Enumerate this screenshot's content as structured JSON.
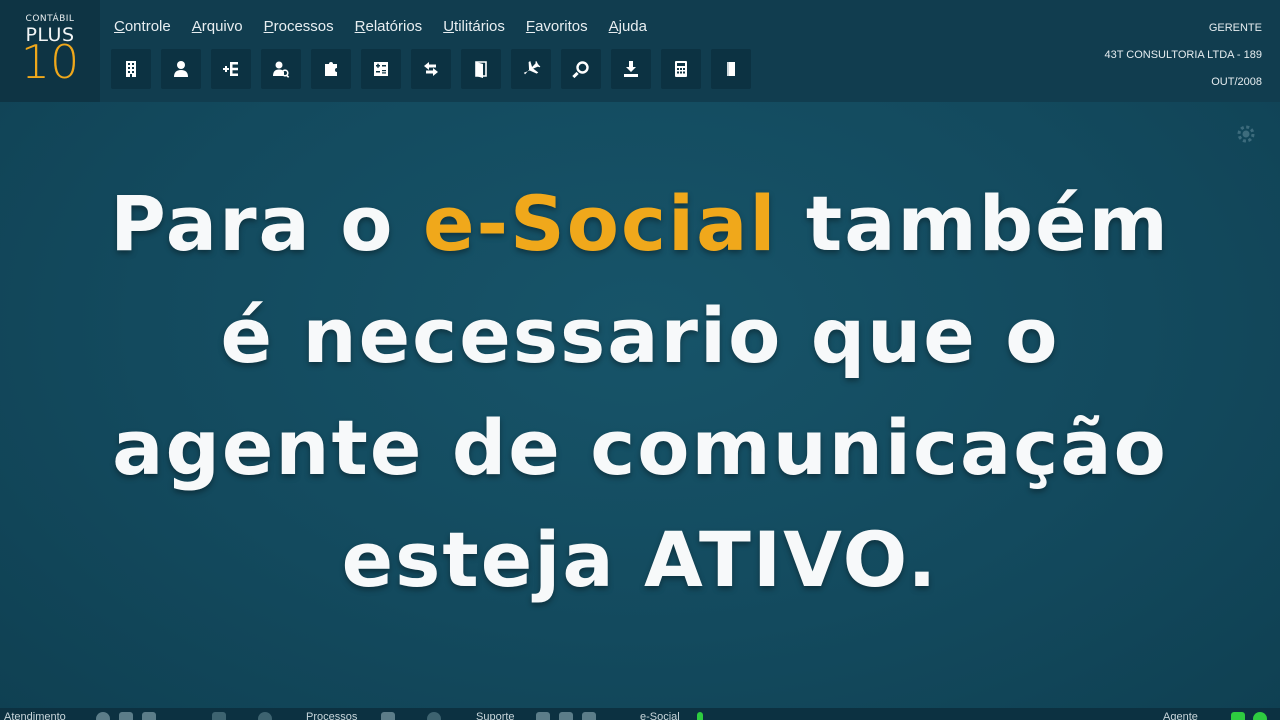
{
  "logo": {
    "small": "CONTÁBIL",
    "plus": "PLUS",
    "number": "10"
  },
  "menu": [
    {
      "first": "C",
      "rest": "ontrole"
    },
    {
      "first": "A",
      "rest": "rquivo"
    },
    {
      "first": "P",
      "rest": "rocessos"
    },
    {
      "first": "R",
      "rest": "elatórios"
    },
    {
      "first": "U",
      "rest": "tilitários"
    },
    {
      "first": "F",
      "rest": "avoritos"
    },
    {
      "first": "Aj",
      "rest": "uda"
    }
  ],
  "toolbar": {
    "icons": [
      "building-icon",
      "person-icon",
      "entry-icon",
      "user-search-icon",
      "puzzle-icon",
      "calc-sheet-icon",
      "transfer-icon",
      "door-icon",
      "airplane-icon",
      "search-icon",
      "download-icon",
      "calculator-icon",
      "book-icon"
    ]
  },
  "user": {
    "role": "GERENTE",
    "company": "43T CONSULTORIA LTDA - 189",
    "period": "OUT/2008"
  },
  "message": {
    "line1_pre": "Para o ",
    "line1_highlight": "e-Social",
    "line1_post": " também",
    "line2": "é necessario que o",
    "line3": "agente de comunicação",
    "line4": "esteja ATIVO."
  },
  "statusbar": {
    "section1": "Atendimento",
    "section2": "Processos",
    "section3": "Suporte",
    "section4": "e-Social",
    "section5": "Agente"
  },
  "colors": {
    "background": "#134a5e",
    "header": "#113d4f",
    "accent": "#f0a81b",
    "text": "#f7f9fa",
    "status_active": "#2ecc40"
  }
}
